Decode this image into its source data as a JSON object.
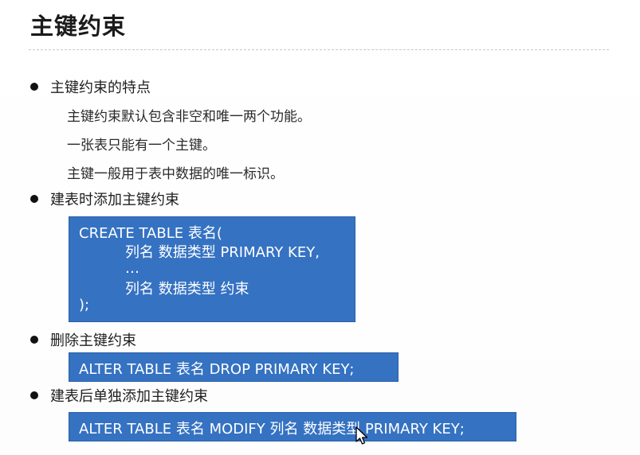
{
  "title": "主键约束",
  "sections": [
    {
      "bullet": "主键约束的特点",
      "lines": [
        "主键约束默认包含非空和唯一两个功能。",
        "一张表只能有一个主键。",
        "主键一般用于表中数据的唯一标识。"
      ]
    },
    {
      "bullet": "建表时添加主键约束",
      "code": [
        "CREATE TABLE 表名(",
        "列名 数据类型 PRIMARY KEY,",
        "…",
        "列名 数据类型 约束",
        ");"
      ]
    },
    {
      "bullet": "删除主键约束",
      "code": [
        "ALTER TABLE 表名 DROP PRIMARY KEY;"
      ]
    },
    {
      "bullet": "建表后单独添加主键约束",
      "code": [
        "ALTER TABLE 表名 MODIFY 列名 数据类型 PRIMARY KEY;"
      ]
    }
  ],
  "colors": {
    "code_background": "#3572c2",
    "code_text": "#ffffff",
    "title_text": "#1a1a1a"
  },
  "icons": {
    "pointer": "mouse-pointer-icon"
  }
}
